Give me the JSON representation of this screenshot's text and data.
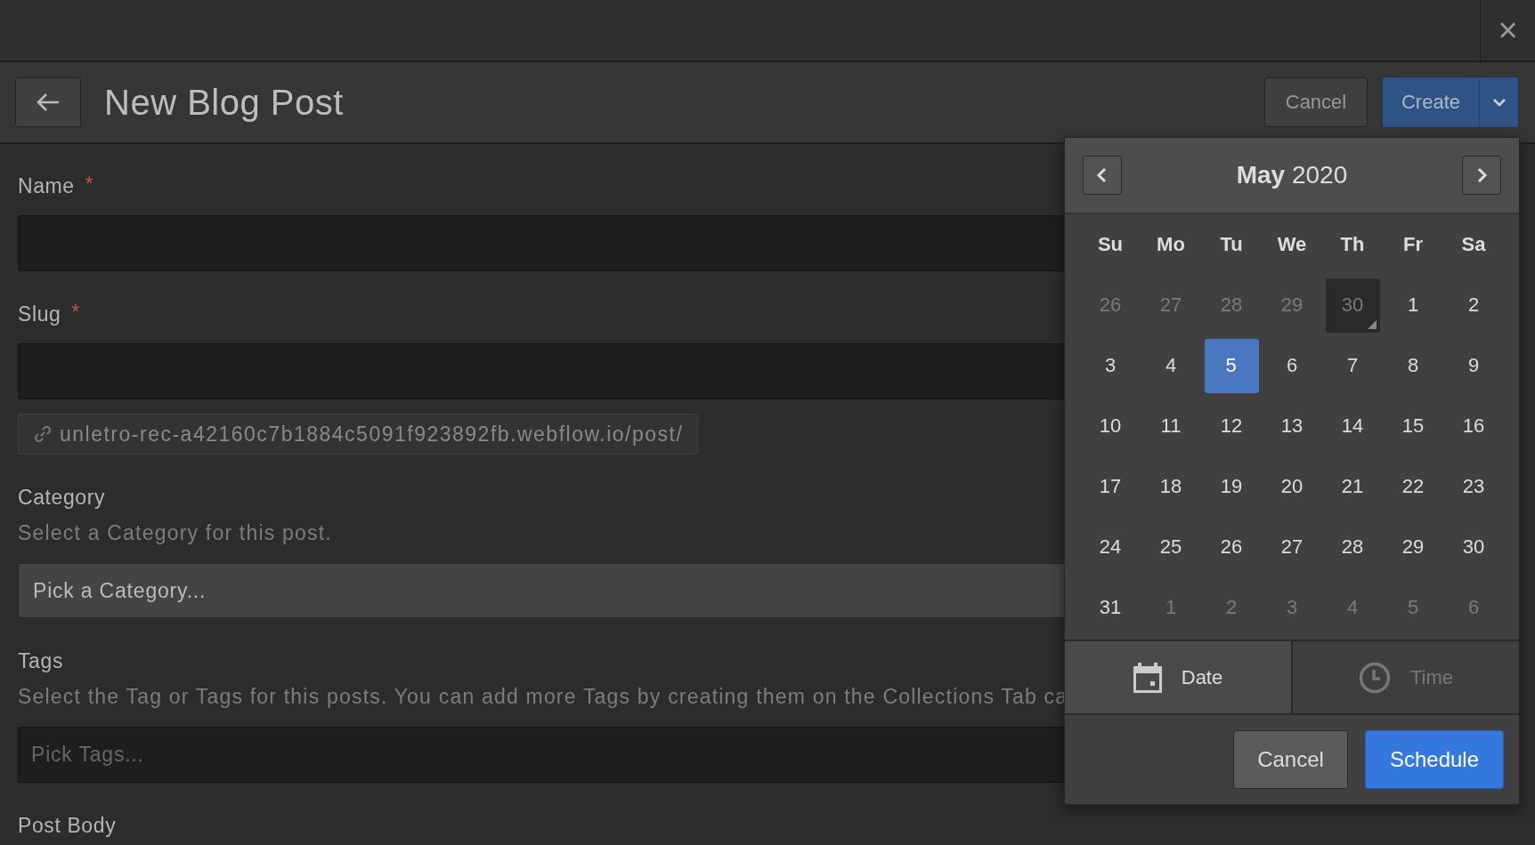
{
  "window": {
    "close": "×"
  },
  "header": {
    "title": "New Blog Post",
    "cancel": "Cancel",
    "create": "Create"
  },
  "form": {
    "fields": [
      {
        "kind": "input",
        "label": "Name",
        "required_mark": "*"
      },
      {
        "kind": "input",
        "label": "Slug",
        "required_mark": "*",
        "url": "unletro-rec-a42160c7b1884c5091f923892fb.webflow.io/post/"
      },
      {
        "kind": "select",
        "label": "Category",
        "description": "Select a Category for this post.",
        "value": "Pick a Category..."
      },
      {
        "kind": "tags",
        "label": "Tags",
        "description": "Select the Tag or Tags for this posts. You can add more Tags by creating them on the Collections Tab ca",
        "placeholder": "Pick Tags..."
      },
      {
        "kind": "heading",
        "label": "Post Body"
      }
    ]
  },
  "calendar": {
    "month": "May",
    "year": "2020",
    "weekdays": [
      "Su",
      "Mo",
      "Tu",
      "We",
      "Th",
      "Fr",
      "Sa"
    ],
    "days": [
      {
        "label": "26",
        "muted": true,
        "today": false,
        "selected": false
      },
      {
        "label": "27",
        "muted": true,
        "today": false,
        "selected": false
      },
      {
        "label": "28",
        "muted": true,
        "today": false,
        "selected": false
      },
      {
        "label": "29",
        "muted": true,
        "today": false,
        "selected": false
      },
      {
        "label": "30",
        "muted": true,
        "today": true,
        "selected": false
      },
      {
        "label": "1",
        "muted": false,
        "today": false,
        "selected": false
      },
      {
        "label": "2",
        "muted": false,
        "today": false,
        "selected": false
      },
      {
        "label": "3",
        "muted": false,
        "today": false,
        "selected": false
      },
      {
        "label": "4",
        "muted": false,
        "today": false,
        "selected": false
      },
      {
        "label": "5",
        "muted": false,
        "today": false,
        "selected": true
      },
      {
        "label": "6",
        "muted": false,
        "today": false,
        "selected": false
      },
      {
        "label": "7",
        "muted": false,
        "today": false,
        "selected": false
      },
      {
        "label": "8",
        "muted": false,
        "today": false,
        "selected": false
      },
      {
        "label": "9",
        "muted": false,
        "today": false,
        "selected": false
      },
      {
        "label": "10",
        "muted": false,
        "today": false,
        "selected": false
      },
      {
        "label": "11",
        "muted": false,
        "today": false,
        "selected": false
      },
      {
        "label": "12",
        "muted": false,
        "today": false,
        "selected": false
      },
      {
        "label": "13",
        "muted": false,
        "today": false,
        "selected": false
      },
      {
        "label": "14",
        "muted": false,
        "today": false,
        "selected": false
      },
      {
        "label": "15",
        "muted": false,
        "today": false,
        "selected": false
      },
      {
        "label": "16",
        "muted": false,
        "today": false,
        "selected": false
      },
      {
        "label": "17",
        "muted": false,
        "today": false,
        "selected": false
      },
      {
        "label": "18",
        "muted": false,
        "today": false,
        "selected": false
      },
      {
        "label": "19",
        "muted": false,
        "today": false,
        "selected": false
      },
      {
        "label": "20",
        "muted": false,
        "today": false,
        "selected": false
      },
      {
        "label": "21",
        "muted": false,
        "today": false,
        "selected": false
      },
      {
        "label": "22",
        "muted": false,
        "today": false,
        "selected": false
      },
      {
        "label": "23",
        "muted": false,
        "today": false,
        "selected": false
      },
      {
        "label": "24",
        "muted": false,
        "today": false,
        "selected": false
      },
      {
        "label": "25",
        "muted": false,
        "today": false,
        "selected": false
      },
      {
        "label": "26",
        "muted": false,
        "today": false,
        "selected": false
      },
      {
        "label": "27",
        "muted": false,
        "today": false,
        "selected": false
      },
      {
        "label": "28",
        "muted": false,
        "today": false,
        "selected": false
      },
      {
        "label": "29",
        "muted": false,
        "today": false,
        "selected": false
      },
      {
        "label": "30",
        "muted": false,
        "today": false,
        "selected": false
      },
      {
        "label": "31",
        "muted": false,
        "today": false,
        "selected": false
      },
      {
        "label": "1",
        "muted": true,
        "today": false,
        "selected": false
      },
      {
        "label": "2",
        "muted": true,
        "today": false,
        "selected": false
      },
      {
        "label": "3",
        "muted": true,
        "today": false,
        "selected": false
      },
      {
        "label": "4",
        "muted": true,
        "today": false,
        "selected": false
      },
      {
        "label": "5",
        "muted": true,
        "today": false,
        "selected": false
      },
      {
        "label": "6",
        "muted": true,
        "today": false,
        "selected": false
      }
    ],
    "tabs": [
      {
        "kind": "date",
        "label": "Date",
        "selected": true
      },
      {
        "kind": "time",
        "label": "Time",
        "selected": false
      }
    ],
    "cancel": "Cancel",
    "schedule": "Schedule"
  }
}
